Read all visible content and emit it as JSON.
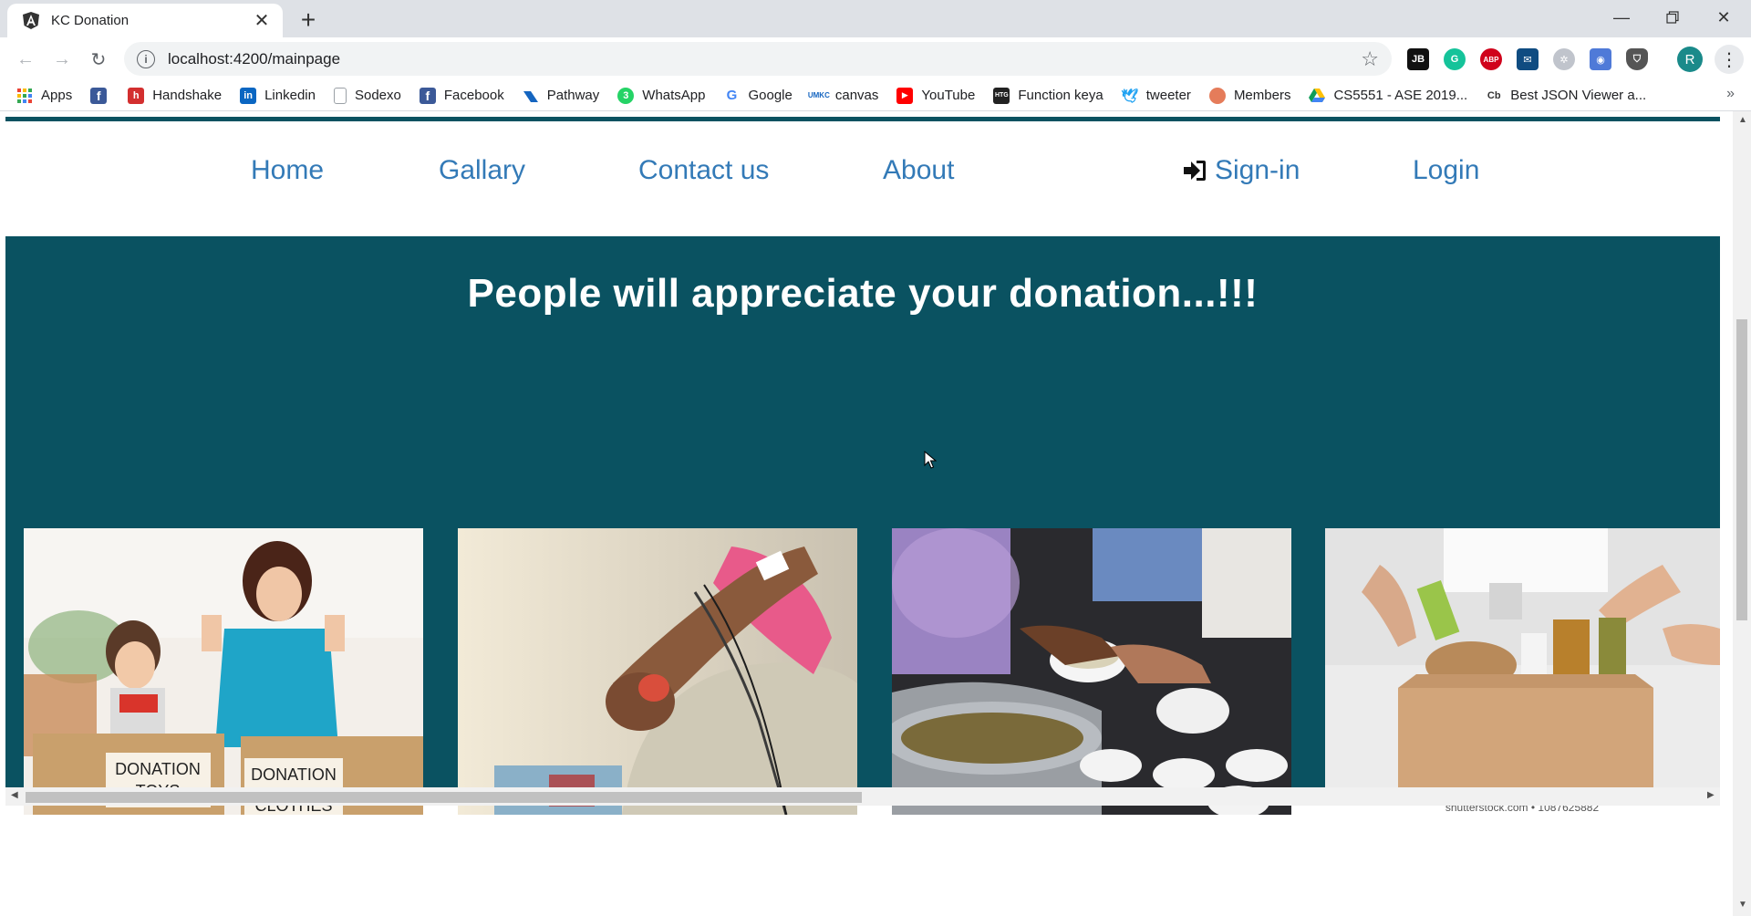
{
  "browser": {
    "tab_title": "KC Donation",
    "url": "localhost:4200/mainpage",
    "profile_initial": "R",
    "bookmarks": [
      {
        "label": "Apps",
        "icon": "apps-grid-icon",
        "color": "#e8453c"
      },
      {
        "label": "",
        "icon": "facebook-icon",
        "color": "#3b5998"
      },
      {
        "label": "Handshake",
        "icon": "handshake-icon",
        "color": "#d32f2f"
      },
      {
        "label": "Linkedin",
        "icon": "linkedin-icon",
        "color": "#0a66c2"
      },
      {
        "label": "Sodexo",
        "icon": "document-icon",
        "color": "#9aa0a6"
      },
      {
        "label": "Facebook",
        "icon": "facebook-icon",
        "color": "#3b5998"
      },
      {
        "label": "Pathway",
        "icon": "pathway-icon",
        "color": "#1565c0"
      },
      {
        "label": "WhatsApp",
        "icon": "whatsapp-icon",
        "color": "#25d366"
      },
      {
        "label": "Google",
        "icon": "google-icon",
        "color": "#ffffff"
      },
      {
        "label": "canvas",
        "icon": "umkc-icon",
        "color": "#1565c0"
      },
      {
        "label": "YouTube",
        "icon": "youtube-icon",
        "color": "#ff0000"
      },
      {
        "label": "Function keya",
        "icon": "htg-icon",
        "color": "#222222"
      },
      {
        "label": "tweeter",
        "icon": "twitter-icon",
        "color": "#1da1f2"
      },
      {
        "label": "Members",
        "icon": "members-icon",
        "color": "#e57c5a"
      },
      {
        "label": "CS5551 - ASE 2019...",
        "icon": "google-drive-icon",
        "color": "#f4b400"
      },
      {
        "label": "Best JSON Viewer a...",
        "icon": "cb-icon",
        "color": "#333333"
      }
    ]
  },
  "site": {
    "nav": {
      "home": "Home",
      "gallery": "Gallary",
      "contact": "Contact us",
      "about": "About",
      "signin": "Sign-in",
      "login": "Login"
    },
    "banner_title": "People will appreciate your donation...!!!",
    "photos": [
      {
        "name": "donation-toys-clothes-photo",
        "box_left": "DONATION",
        "box_left_2": "TOYS",
        "box_right": "DONATION",
        "box_right_2": "CLOTHES"
      },
      {
        "name": "blood-donation-photo"
      },
      {
        "name": "food-serving-photo"
      },
      {
        "name": "food-box-donation-photo",
        "watermark": "shutterstock.com • 1087625882"
      }
    ]
  },
  "colors": {
    "banner_bg": "#0a5261",
    "nav_link": "#337ab7"
  }
}
